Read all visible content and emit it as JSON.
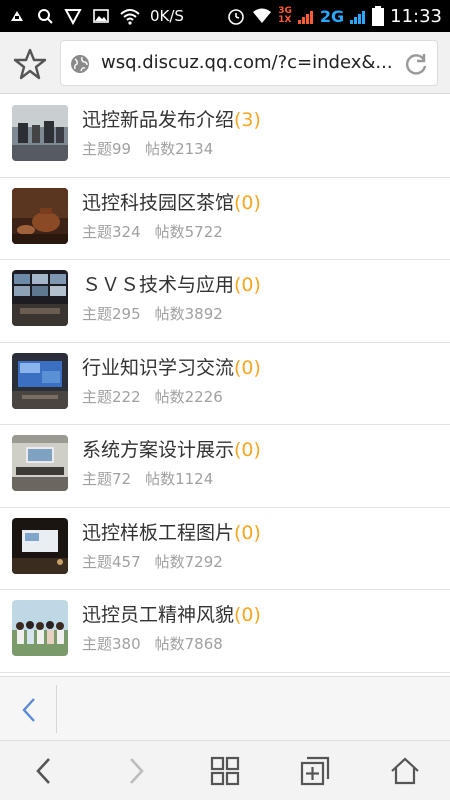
{
  "status_bar": {
    "speed": "0K/S",
    "net_top": "3G",
    "net_bottom": "1X",
    "net_2g": "2G",
    "time": "11:33"
  },
  "browser": {
    "url": "wsq.discuz.qq.com/?c=index&..."
  },
  "forums": [
    {
      "title": "迅控新品发布介绍",
      "new_count": "(3)",
      "topics": "主题99",
      "posts": "帖数2134"
    },
    {
      "title": "迅控科技园区茶馆",
      "new_count": "(0)",
      "topics": "主题324",
      "posts": "帖数5722"
    },
    {
      "title": "ＳＶＳ技术与应用",
      "new_count": "(0)",
      "topics": "主题295",
      "posts": "帖数3892"
    },
    {
      "title": "行业知识学习交流",
      "new_count": "(0)",
      "topics": "主题222",
      "posts": "帖数2226"
    },
    {
      "title": "系统方案设计展示",
      "new_count": "(0)",
      "topics": "主题72",
      "posts": "帖数1124"
    },
    {
      "title": "迅控样板工程图片",
      "new_count": "(0)",
      "topics": "主题457",
      "posts": "帖数7292"
    },
    {
      "title": "迅控员工精神风貌",
      "new_count": "(0)",
      "topics": "主题380",
      "posts": "帖数7868"
    }
  ],
  "icons": {
    "favorite": "star-icon",
    "site": "globe-icon",
    "reload": "refresh-icon",
    "page_back": "chevron-left-icon",
    "nav_back": "back-arrow-icon",
    "nav_forward": "forward-arrow-icon",
    "windows": "grid-icon",
    "new_tab": "add-tab-icon",
    "home": "home-icon"
  },
  "colors": {
    "accent_count": "#f5a623",
    "net_2g": "#2aa8ff",
    "net_3g": "#ff5a36"
  }
}
